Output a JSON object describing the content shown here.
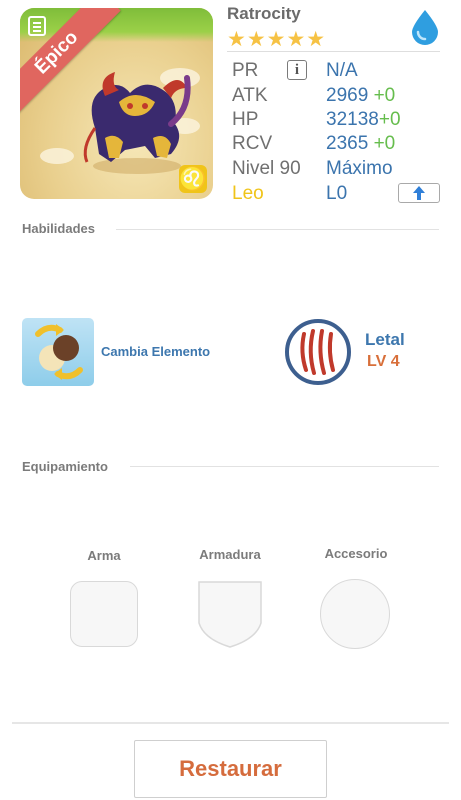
{
  "portrait": {
    "rarity_label": "Épico",
    "zodiac_symbol": "♌",
    "icon_names": [
      "notes-icon",
      "leo-zodiac-icon",
      "creature-portrait"
    ]
  },
  "header": {
    "name": "Ratrocity",
    "stars": "★★★★★",
    "star_count": 5,
    "element_icon": "water-drop-icon",
    "colors": {
      "star": "#f6c244",
      "element": "#2f9ee0"
    }
  },
  "stats": {
    "pr": {
      "label": "PR",
      "value": "N/A"
    },
    "atk": {
      "label": "ATK",
      "value": "2969",
      "bonus": "+0"
    },
    "hp": {
      "label": "HP",
      "value": "32138",
      "bonus": "+0"
    },
    "rcv": {
      "label": "RCV",
      "value": "2365",
      "bonus": "+0"
    },
    "level": {
      "label": "Nivel 90",
      "value": "Máximo"
    },
    "sign": {
      "label": "Leo",
      "value": "L0"
    },
    "info_icon_glyph": "i",
    "colors": {
      "value": "#3b74ad",
      "bonus": "#66bd4d",
      "sign": "#f0c419"
    }
  },
  "abilities": {
    "title": "Habilidades",
    "skill": {
      "name": "Cambia Elemento",
      "icon": "swap-element-icon"
    },
    "passive": {
      "name": "Letal",
      "level": "LV 4",
      "icon": "claw-marks-icon"
    }
  },
  "equipment": {
    "title": "Equipamiento",
    "slots": [
      {
        "label": "Arma",
        "icon": "weapon-slot"
      },
      {
        "label": "Armadura",
        "icon": "armor-slot"
      },
      {
        "label": "Accesorio",
        "icon": "accessory-slot"
      }
    ]
  },
  "footer": {
    "restore_label": "Restaurar",
    "colors": {
      "restore": "#d56c3d"
    }
  }
}
